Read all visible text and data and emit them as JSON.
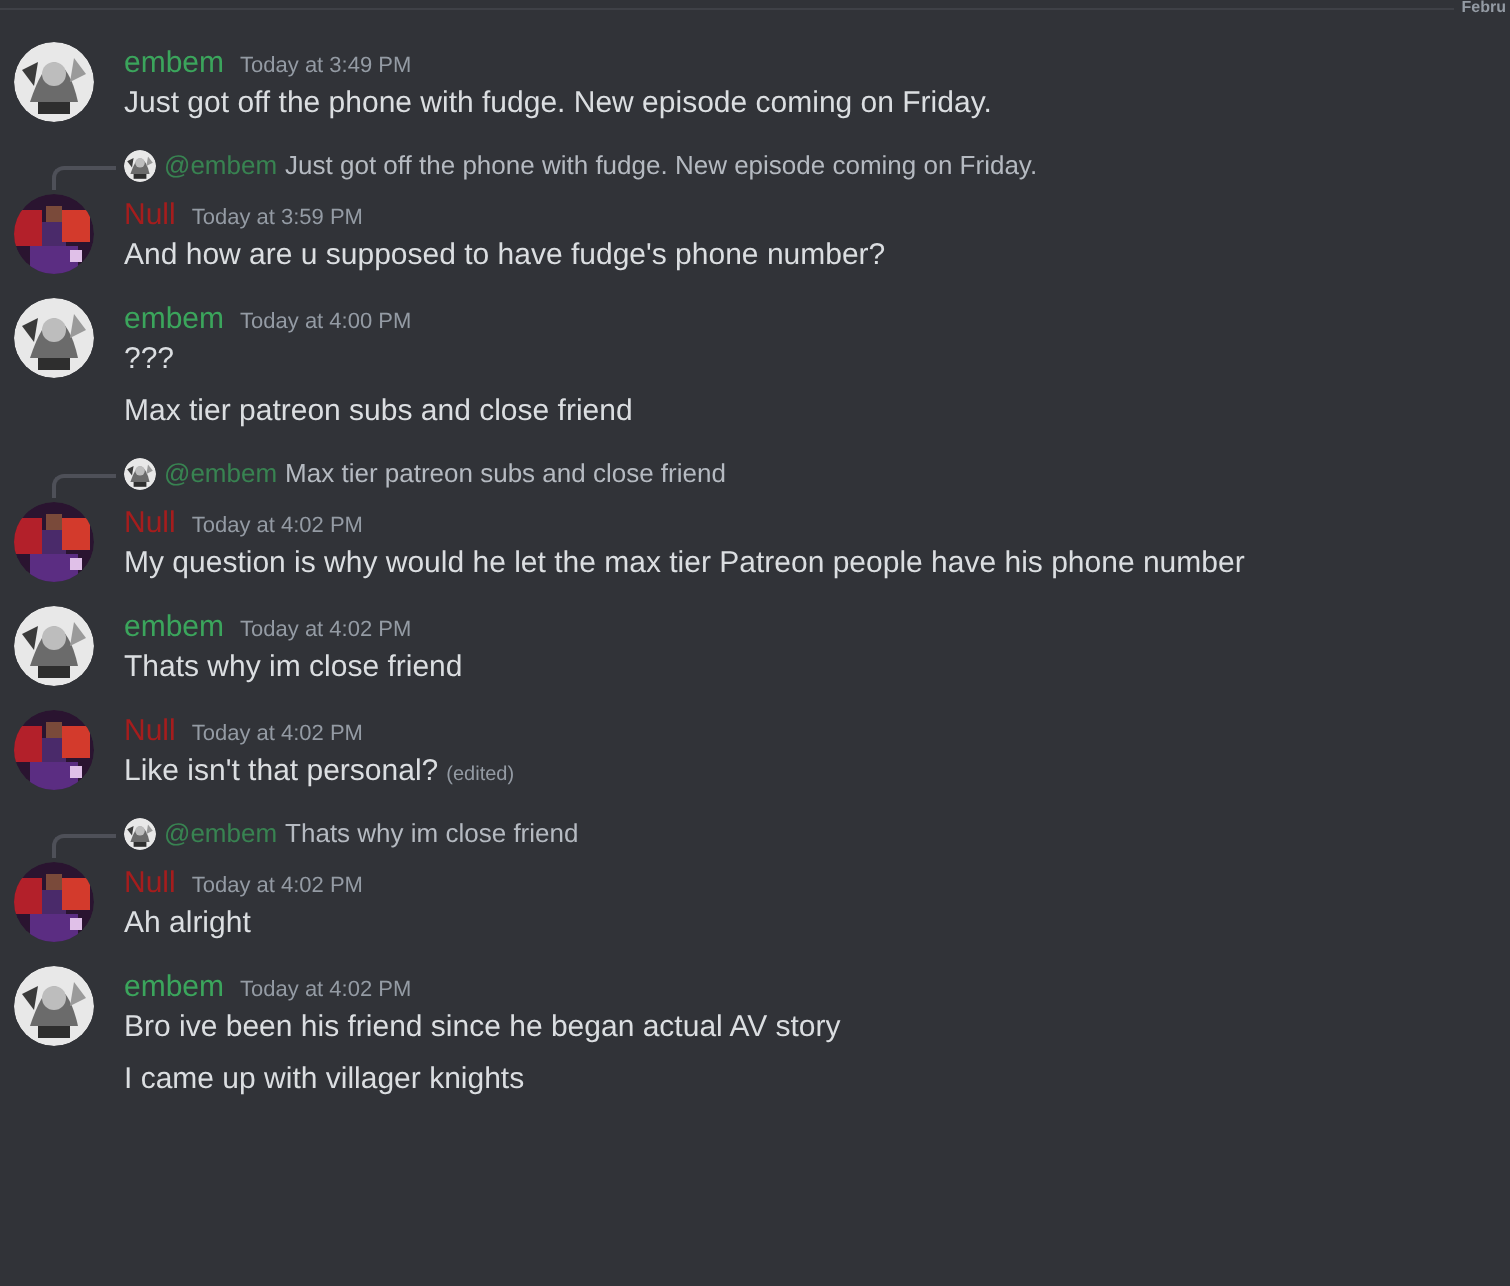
{
  "divider": {
    "label": "Febru"
  },
  "messages": [
    {
      "author": "embem",
      "color": "#3ba55c",
      "kind": "sketch",
      "time": "Today at 3:49 PM",
      "lines": [
        {
          "text": "Just got off the phone with fudge. New episode coming on Friday."
        }
      ]
    },
    {
      "reply": {
        "mention": "@embem",
        "text": "Just got off the phone with fudge. New episode coming on Friday."
      },
      "author": "Null",
      "color": "#a51d1d",
      "kind": "pixel",
      "time": "Today at 3:59 PM",
      "lines": [
        {
          "text": "And how are u supposed to have fudge's phone number?"
        }
      ]
    },
    {
      "author": "embem",
      "color": "#3ba55c",
      "kind": "sketch",
      "time": "Today at 4:00 PM",
      "lines": [
        {
          "text": "???"
        },
        {
          "text": "Max tier patreon subs and close friend"
        }
      ]
    },
    {
      "reply": {
        "mention": "@embem",
        "text": "Max tier patreon subs and close friend"
      },
      "author": "Null",
      "color": "#a51d1d",
      "kind": "pixel",
      "time": "Today at 4:02 PM",
      "lines": [
        {
          "text": "My question is why would he let the max tier Patreon people have his phone number"
        }
      ]
    },
    {
      "author": "embem",
      "color": "#3ba55c",
      "kind": "sketch",
      "time": "Today at 4:02 PM",
      "lines": [
        {
          "text": "Thats why im close friend"
        }
      ]
    },
    {
      "author": "Null",
      "color": "#a51d1d",
      "kind": "pixel",
      "time": "Today at 4:02 PM",
      "lines": [
        {
          "text": "Like isn't that personal?",
          "edited_label": "(edited)"
        }
      ]
    },
    {
      "reply": {
        "mention": "@embem",
        "text": "Thats why im close friend"
      },
      "author": "Null",
      "color": "#a51d1d",
      "kind": "pixel",
      "time": "Today at 4:02 PM",
      "lines": [
        {
          "text": "Ah alright"
        }
      ]
    },
    {
      "author": "embem",
      "color": "#3ba55c",
      "kind": "sketch",
      "time": "Today at 4:02 PM",
      "lines": [
        {
          "text": "Bro ive been his friend since he began actual AV story"
        },
        {
          "text": "I came up with villager knights"
        }
      ]
    }
  ]
}
